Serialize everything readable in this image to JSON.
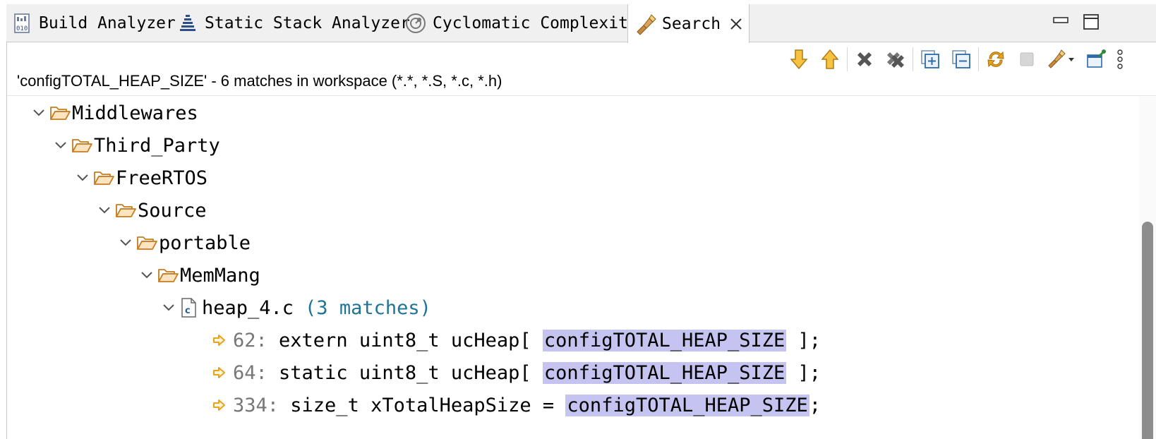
{
  "tabs": [
    {
      "label": "Build Analyzer",
      "icon": "build-analyzer-icon"
    },
    {
      "label": "Static Stack Analyzer",
      "icon": "stack-analyzer-icon"
    },
    {
      "label": "Cyclomatic Complexity",
      "icon": "complexity-icon"
    },
    {
      "label": "Search",
      "icon": "search-flashlight-icon",
      "active": true
    }
  ],
  "summary": "'configTOTAL_HEAP_SIZE' - 6 matches in workspace (*.*, *.S, *.c, *.h)",
  "tree": {
    "folders": [
      "Middlewares",
      "Third_Party",
      "FreeRTOS",
      "Source",
      "portable",
      "MemMang"
    ],
    "file": {
      "name": "heap_4.c",
      "matches": "(3 matches)"
    },
    "matches": [
      {
        "line": "62:",
        "before": " extern uint8_t ucHeap[ ",
        "hit": "configTOTAL_HEAP_SIZE",
        "after": " ];"
      },
      {
        "line": "64:",
        "before": " static uint8_t ucHeap[ ",
        "hit": "configTOTAL_HEAP_SIZE",
        "after": " ];"
      },
      {
        "line": "334:",
        "before": " size_t xTotalHeapSize = ",
        "hit": "configTOTAL_HEAP_SIZE",
        "after": ";"
      }
    ]
  },
  "colors": {
    "highlight": "#c5c4f0",
    "match_count": "#1f7396",
    "folder": "#d58a2b",
    "arrow": "#e8a21b"
  }
}
